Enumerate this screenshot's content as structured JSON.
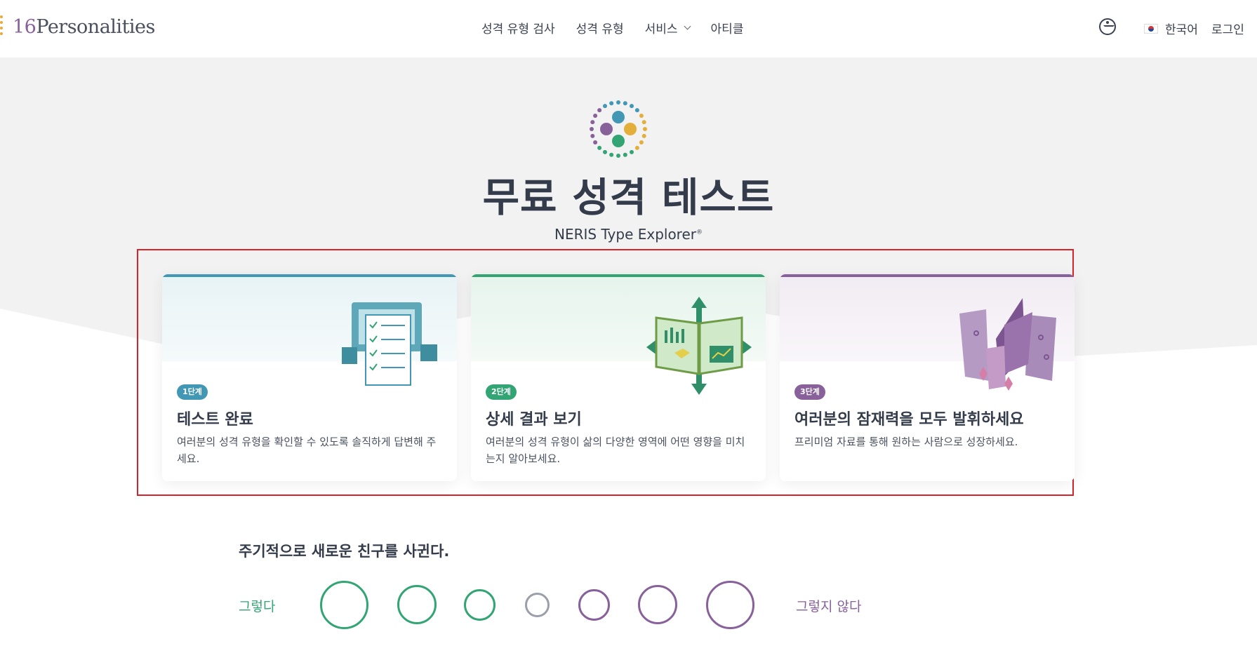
{
  "header": {
    "logo_number": "16",
    "logo_text": "Personalities",
    "nav": [
      "성격 유형 검사",
      "성격 유형",
      "서비스",
      "아티클"
    ],
    "language": "한국어",
    "login": "로그인"
  },
  "hero": {
    "title": "무료 성격 테스트",
    "subtitle": "NERIS Type Explorer",
    "subtitle_mark": "®"
  },
  "steps": [
    {
      "badge": "1단계",
      "title": "테스트 완료",
      "description": "여러분의 성격 유형을 확인할 수 있도록 솔직하게 답변해 주세요.",
      "color": "#4298b4"
    },
    {
      "badge": "2단계",
      "title": "상세 결과 보기",
      "description": "여러분의 성격 유형이 삶의 다양한 영역에 어떤 영향을 미치는지 알아보세요.",
      "color": "#33a474"
    },
    {
      "badge": "3단계",
      "title": "여러분의 잠재력을 모두 발휘하세요",
      "description": "프리미엄 자료를 통해 원하는 사람으로 성장하세요.",
      "color": "#88619a"
    }
  ],
  "question": {
    "text": "주기적으로 새로운 친구를 사귄다.",
    "agree": "그렇다",
    "disagree": "그렇지 않다",
    "options": 7
  },
  "colors": {
    "agree": "#33a474",
    "neutral": "#9b9faa",
    "disagree": "#88619a",
    "highlight": "#d8232a"
  }
}
